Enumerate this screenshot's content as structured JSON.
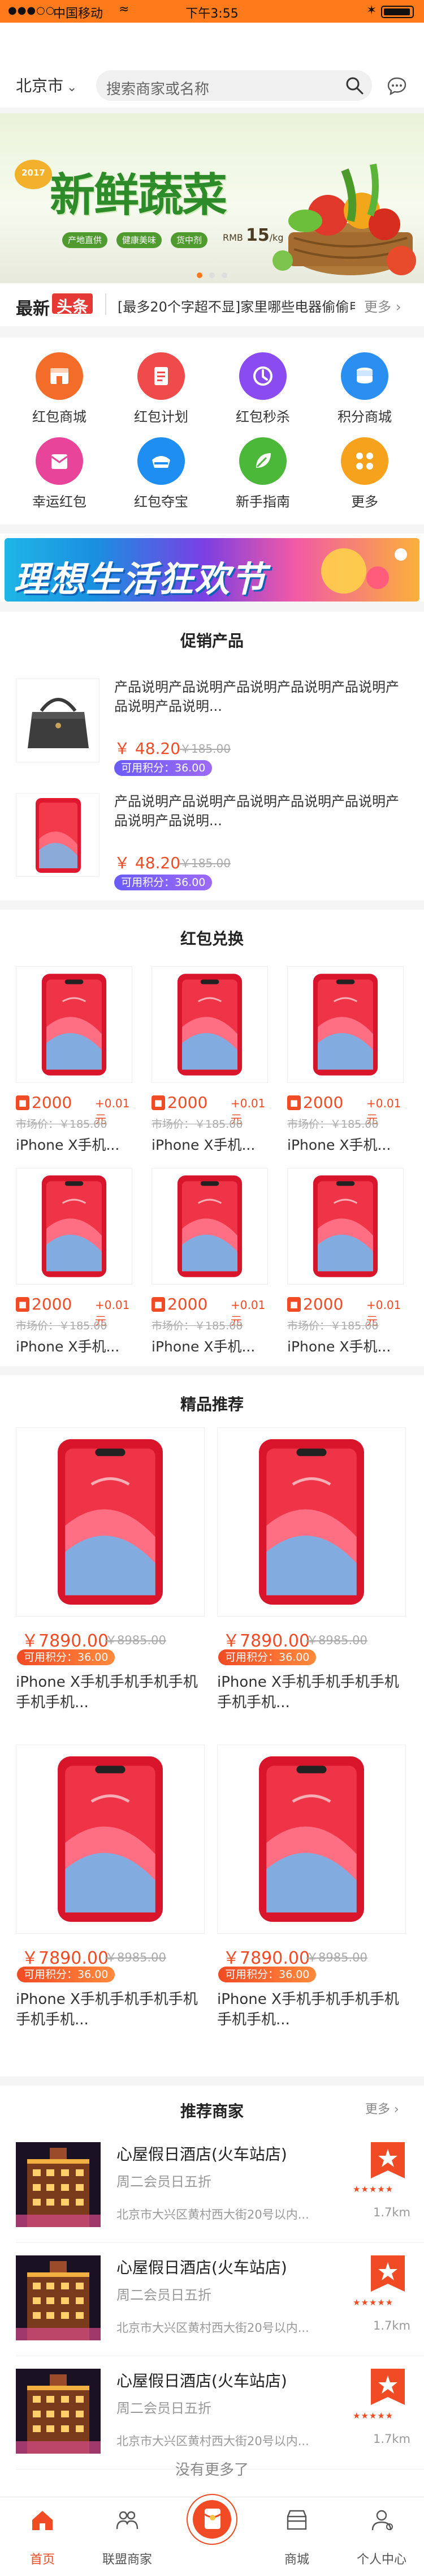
{
  "statusbar": {
    "signal": "●●●○○",
    "carrier": "中国移动",
    "time": "下午3:55"
  },
  "header": {
    "city": "北京市",
    "search_placeholder": "搜索商家或名称"
  },
  "banner": {
    "year": "2017",
    "title": "新鲜蔬菜",
    "tags": [
      "产地直供",
      "健康美味",
      "货中剂"
    ],
    "price_prefix": "RMB",
    "price": "15",
    "price_unit": "/kg"
  },
  "news": {
    "logo_a": "最新",
    "logo_b": "头条",
    "text": "[最多20个字超不显]家里哪些电器偷偷电...",
    "more": "更多"
  },
  "categories": [
    {
      "label": "红包商城",
      "color": "#f36c2a",
      "icon": "store-icon"
    },
    {
      "label": "红包计划",
      "color": "#f04b4b",
      "icon": "plan-icon"
    },
    {
      "label": "红包秒杀",
      "color": "#8a4cf0",
      "icon": "flash-sale-icon"
    },
    {
      "label": "积分商城",
      "color": "#2a8ff0",
      "icon": "coins-icon"
    },
    {
      "label": "幸运红包",
      "color": "#e8459a",
      "icon": "lucky-envelope-icon"
    },
    {
      "label": "红包夺宝",
      "color": "#1e8ef2",
      "icon": "treasure-icon"
    },
    {
      "label": "新手指南",
      "color": "#4bb83a",
      "icon": "guide-icon"
    },
    {
      "label": "更多",
      "color": "#f6a21c",
      "icon": "more-grid-icon"
    }
  ],
  "promo_banner": {
    "text": "理想生活狂欢节"
  },
  "promotions": {
    "title": "促销产品",
    "items": [
      {
        "desc": "产品说明产品说明产品说明产品说明产品说明产品说明产品说明...",
        "price": "￥ 48.20",
        "old_price": "￥185.00",
        "points": "可用积分：36.00"
      },
      {
        "desc": "产品说明产品说明产品说明产品说明产品说明产品说明产品说明...",
        "price": "￥ 48.20",
        "old_price": "￥185.00",
        "points": "可用积分：36.00"
      }
    ]
  },
  "redpacket": {
    "title": "红包兑换",
    "items": [
      {
        "points": "2000",
        "plus": "+0.01元",
        "market": "市场价：￥185.00",
        "name": "iPhone X手机..."
      },
      {
        "points": "2000",
        "plus": "+0.01元",
        "market": "市场价：￥185.00",
        "name": "iPhone X手机..."
      },
      {
        "points": "2000",
        "plus": "+0.01元",
        "market": "市场价：￥185.00",
        "name": "iPhone X手机..."
      },
      {
        "points": "2000",
        "plus": "+0.01元",
        "market": "市场价：￥185.00",
        "name": "iPhone X手机..."
      },
      {
        "points": "2000",
        "plus": "+0.01元",
        "market": "市场价：￥185.00",
        "name": "iPhone X手机..."
      },
      {
        "points": "2000",
        "plus": "+0.01元",
        "market": "市场价：￥185.00",
        "name": "iPhone X手机..."
      }
    ]
  },
  "featured": {
    "title": "精品推荐",
    "items": [
      {
        "price": "￥7890.00",
        "old_price": "￥8985.00",
        "points": "可用积分：36.00",
        "name": "iPhone X手机手机手机手机手机手机..."
      },
      {
        "price": "￥7890.00",
        "old_price": "￥8985.00",
        "points": "可用积分：36.00",
        "name": "iPhone X手机手机手机手机手机手机..."
      },
      {
        "price": "￥7890.00",
        "old_price": "￥8985.00",
        "points": "可用积分：36.00",
        "name": "iPhone X手机手机手机手机手机手机..."
      },
      {
        "price": "￥7890.00",
        "old_price": "￥8985.00",
        "points": "可用积分：36.00",
        "name": "iPhone X手机手机手机手机手机手机..."
      }
    ]
  },
  "merchants": {
    "title": "推荐商家",
    "more": "更多 ›",
    "items": [
      {
        "name": "心屋假日酒店(火车站店)",
        "sub": "周二会员日五折",
        "addr": "北京市大兴区黄村西大街20号以内...",
        "dist": "1.7km",
        "stars": "★★★★★"
      },
      {
        "name": "心屋假日酒店(火车站店)",
        "sub": "周二会员日五折",
        "addr": "北京市大兴区黄村西大街20号以内...",
        "dist": "1.7km",
        "stars": "★★★★★"
      },
      {
        "name": "心屋假日酒店(火车站店)",
        "sub": "周二会员日五折",
        "addr": "北京市大兴区黄村西大街20号以内...",
        "dist": "1.7km",
        "stars": "★★★★★"
      }
    ],
    "no_more": "没有更多了"
  },
  "tabbar": {
    "tabs": [
      {
        "label": "首页"
      },
      {
        "label": "联盟商家"
      },
      {
        "label": ""
      },
      {
        "label": "商城"
      },
      {
        "label": "个人中心"
      }
    ],
    "active": 0
  },
  "colors": {
    "brand": "#ff7a1a",
    "price": "#f04b24",
    "points_bg": "#7b5cf5"
  }
}
